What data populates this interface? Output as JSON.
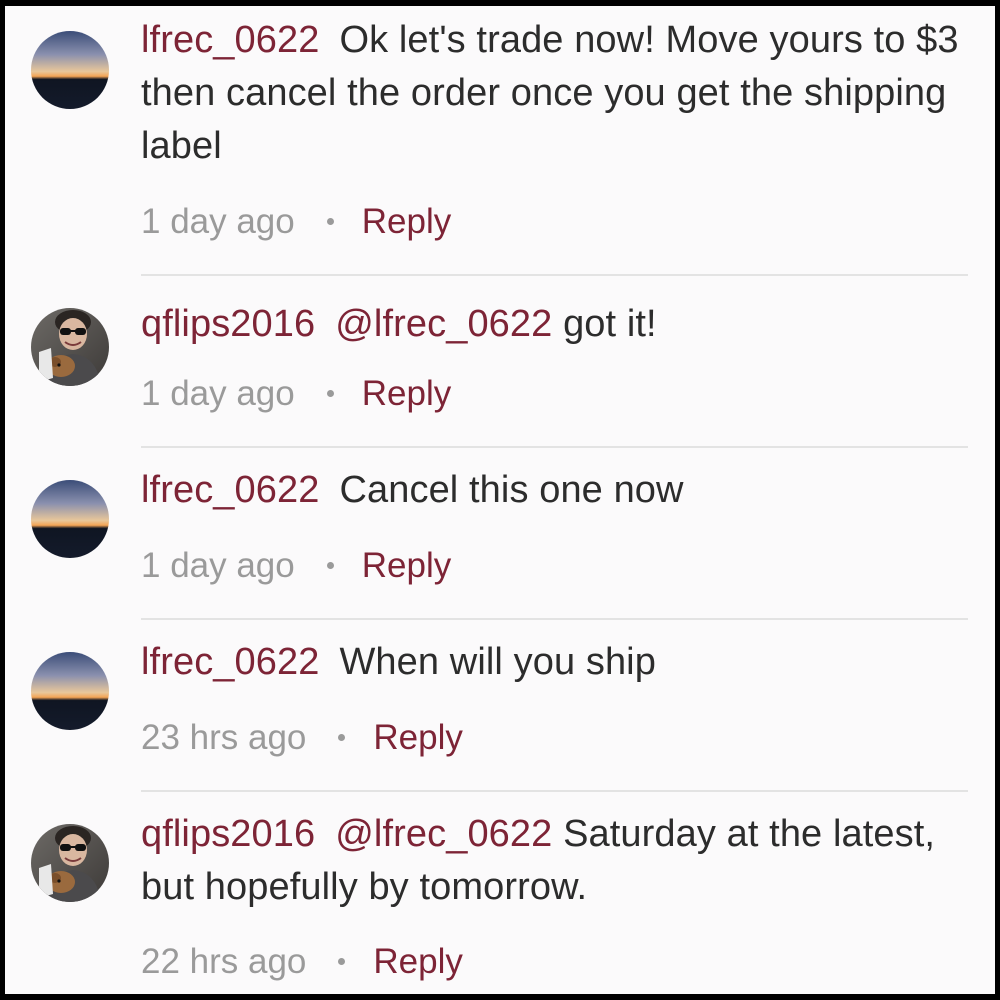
{
  "comments": [
    {
      "username": "lfrec_0622",
      "mention": "",
      "text": "Ok let's trade now! Move yours to $3 then cancel the order once you get the shipping label",
      "time": "1 day ago",
      "reply_label": "Reply",
      "avatar": "sunset-avatar"
    },
    {
      "username": "qflips2016",
      "mention": "@lfrec_0622",
      "text": "got it!",
      "time": "1 day ago",
      "reply_label": "Reply",
      "avatar": "person-with-dog-avatar"
    },
    {
      "username": "lfrec_0622",
      "mention": "",
      "text": "Cancel this one now",
      "time": "1 day ago",
      "reply_label": "Reply",
      "avatar": "sunset-avatar"
    },
    {
      "username": "lfrec_0622",
      "mention": "",
      "text": "When will you ship",
      "time": "23 hrs ago",
      "reply_label": "Reply",
      "avatar": "sunset-avatar"
    },
    {
      "username": "qflips2016",
      "mention": "@lfrec_0622",
      "text": "Saturday at the latest, but hopefully by tomorrow.",
      "time": "22 hrs ago",
      "reply_label": "Reply",
      "avatar": "person-with-dog-avatar"
    }
  ],
  "colors": {
    "username": "#7d2436",
    "body_text": "#2c2c2c",
    "meta_text": "#9a9a9a",
    "background": "#fbfafb",
    "divider": "#e3e3e3"
  }
}
